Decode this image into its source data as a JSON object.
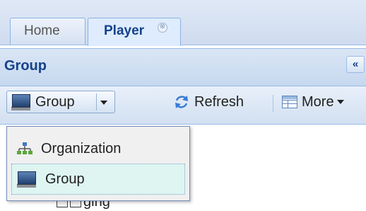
{
  "tabs": [
    {
      "label": "Home",
      "active": false
    },
    {
      "label": "Player",
      "active": true,
      "close_glyph": "⊗"
    }
  ],
  "panel": {
    "title": "Group",
    "collapse_glyph": "«"
  },
  "toolbar": {
    "group_label": "Group",
    "refresh_label": "Refresh",
    "more_label": "More"
  },
  "menu": {
    "items": [
      {
        "label": "Organization",
        "icon": "org-chart-icon",
        "highlighted": false
      },
      {
        "label": "Group",
        "icon": "monitor-icon",
        "highlighted": true
      }
    ]
  },
  "tree": {
    "partial_node_label": "ging"
  },
  "colors": {
    "header_text": "#15428b",
    "border": "#99bbe8",
    "menu_highlight": "#def5f1"
  }
}
